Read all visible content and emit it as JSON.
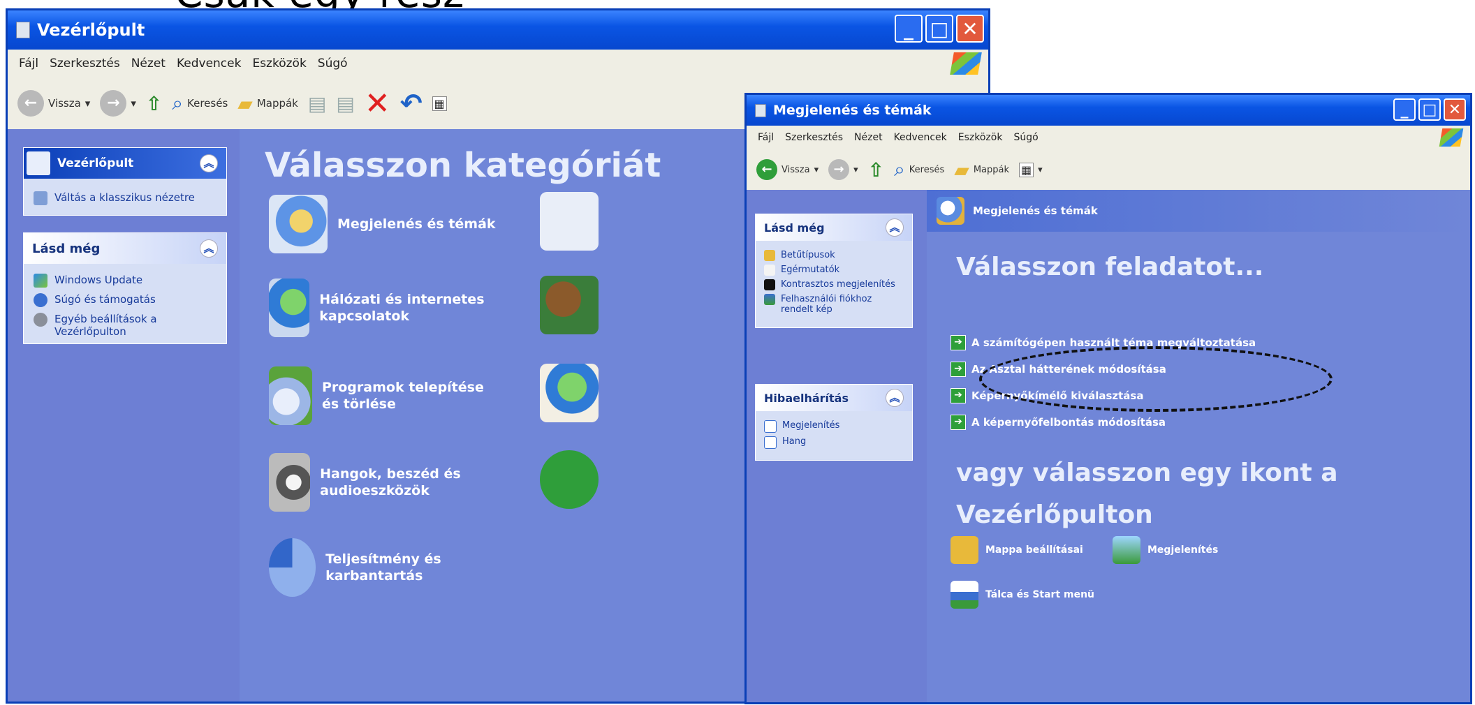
{
  "window1": {
    "title": "Vezérlőpult",
    "menu": [
      "Fájl",
      "Szerkesztés",
      "Nézet",
      "Kedvencek",
      "Eszközök",
      "Súgó"
    ],
    "toolbar": {
      "back": "Vissza",
      "search": "Keresés",
      "folders": "Mappák"
    },
    "panel_main": {
      "title": "Vezérlőpult",
      "items": [
        "Váltás a klasszikus nézetre"
      ]
    },
    "panel_see_also": {
      "title": "Lásd még",
      "items": [
        "Windows Update",
        "Súgó és támogatás",
        "Egyéb beállítások a Vezérlőpulton"
      ]
    },
    "headline": "Válasszon kategóriát",
    "categories": [
      {
        "label": "Megjelenés és témák",
        "icon": "appearance-icon"
      },
      {
        "label": "Hálózati és internetes kapcsolatok",
        "icon": "network-globe-icon"
      },
      {
        "label": "Programok telepítése és törlése",
        "icon": "add-remove-programs-icon"
      },
      {
        "label": "Hangok, beszéd és audioeszközök",
        "icon": "sound-speaker-icon"
      },
      {
        "label": "Teljesítmény és karbantartás",
        "icon": "performance-pie-icon"
      }
    ],
    "right_icons": [
      "printer-icon",
      "user-accounts-icon",
      "date-time-globe-icon",
      "accessibility-icon"
    ]
  },
  "window2": {
    "title": "Megjelenés és témák",
    "menu": [
      "Fájl",
      "Szerkesztés",
      "Nézet",
      "Kedvencek",
      "Eszközök",
      "Súgó"
    ],
    "toolbar": {
      "back": "Vissza",
      "search": "Keresés",
      "folders": "Mappák"
    },
    "panel_see_also": {
      "title": "Lásd még",
      "items": [
        "Betűtípusok",
        "Egérmutatók",
        "Kontrasztos megjelenítés",
        "Felhasználói fiókhoz rendelt kép"
      ]
    },
    "panel_trouble": {
      "title": "Hibaelhárítás",
      "items": [
        "Megjelenítés",
        "Hang"
      ]
    },
    "section_header": "Megjelenés és témák",
    "headline": "Válasszon feladatot...",
    "tasks": [
      "A számítógépen használt téma megváltoztatása",
      "Az Asztal hátterének módosítása",
      "Képernyőkímélő kiválasztása",
      "A képernyőfelbontás módosítása"
    ],
    "subheadline_line1": "vagy válasszon egy ikont a",
    "subheadline_line2": "Vezérlőpulton",
    "icons": [
      {
        "label": "Mappa beállításai",
        "icon": "folder-options-icon"
      },
      {
        "label": "Megjelenítés",
        "icon": "display-icon"
      },
      {
        "label": "Tálca és Start menü",
        "icon": "taskbar-start-icon"
      }
    ]
  }
}
